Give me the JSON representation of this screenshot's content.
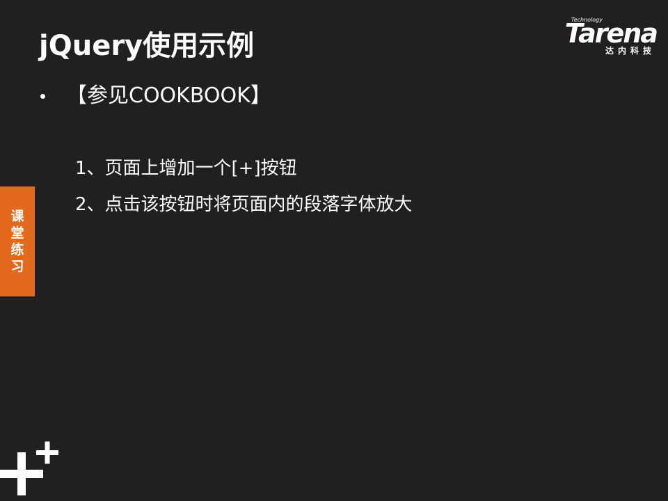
{
  "slide": {
    "title": "jQuery使用示例",
    "logo": {
      "tagline": "Technology",
      "wordmark": "Tarena",
      "cn": "达内科技"
    },
    "bullet": "【参见COOKBOOK】",
    "items": [
      "1、页面上增加一个[+]按钮",
      "2、点击该按钮时将页面内的段落字体放大"
    ],
    "side_tab": [
      "课",
      "堂",
      "练",
      "习"
    ],
    "colors": {
      "background": "#221f20",
      "accent": "#e3691d",
      "text": "#ffffff"
    },
    "icons": {
      "corner": "plus-decoration-icon"
    }
  }
}
